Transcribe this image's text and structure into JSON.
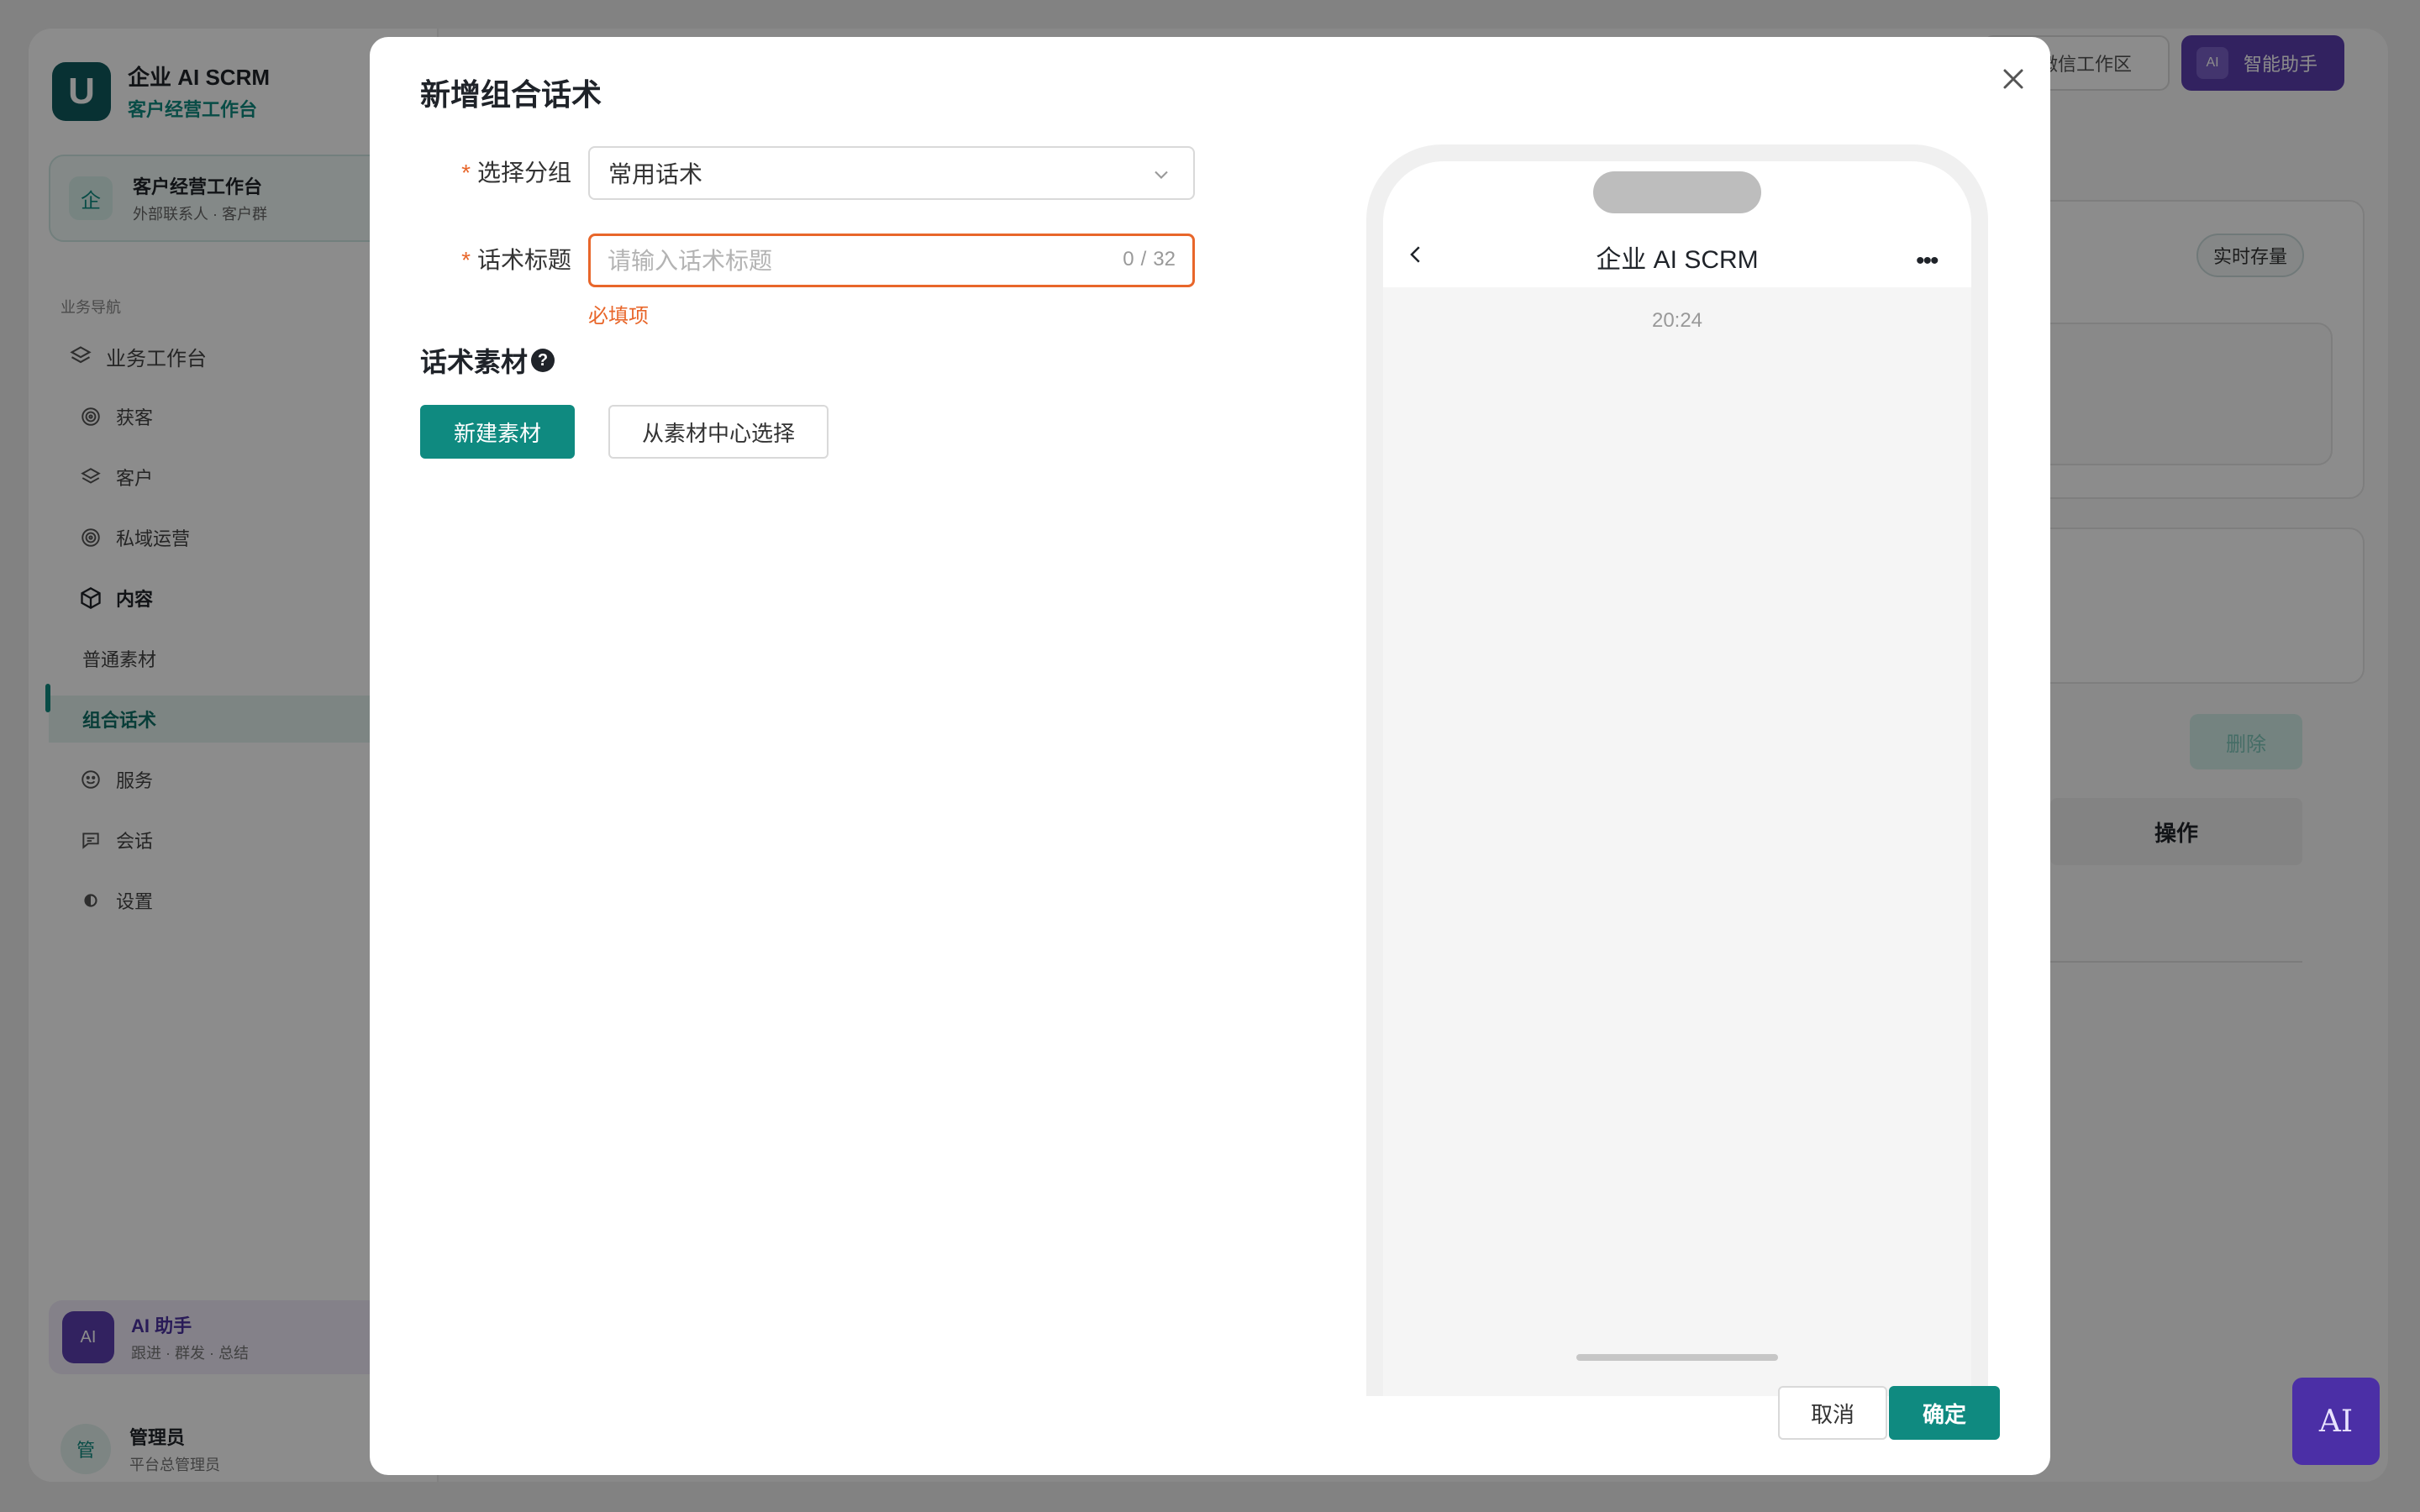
{
  "app": {
    "brand_name": "企业 AI SCRM",
    "brand_sub": "客户经营工作台",
    "workspace": {
      "icon_char": "企",
      "title": "客户经营工作台",
      "sub": "外部联系人 · 客户群"
    },
    "nav_label": "业务导航",
    "nav": [
      {
        "label": "业务工作台",
        "icon": "layers-icon"
      },
      {
        "label": "获客",
        "icon": "target-icon"
      },
      {
        "label": "客户",
        "icon": "layers-icon"
      },
      {
        "label": "私域运营",
        "icon": "target-icon"
      },
      {
        "label": "内容",
        "icon": "cube-icon"
      },
      {
        "label": "普通素材"
      },
      {
        "label": "组合话术"
      },
      {
        "label": "服务",
        "icon": "smile-icon"
      },
      {
        "label": "会话",
        "icon": "chat-icon"
      },
      {
        "label": "设置",
        "icon": "settings-icon"
      }
    ],
    "ai_card": {
      "badge": "AI",
      "title": "AI 助手",
      "sub": "跟进 · 群发 · 总结"
    },
    "user": {
      "avatar": "管",
      "name": "管理员",
      "sub": "平台总管理员"
    },
    "top": {
      "workbench_label": "业微信工作区",
      "ai_badge": "AI",
      "ai_label": "智能助手"
    },
    "realtime_label": "实时存量",
    "delete_label": "删除",
    "table_action_header": "操作",
    "ai_float_label": "AI"
  },
  "modal": {
    "title": "新增组合话术",
    "group_label": "选择分组",
    "group_value": "常用话术",
    "title_label": "话术标题",
    "title_placeholder": "请输入话术标题",
    "title_value": "",
    "count_current": "0",
    "count_max": "32",
    "error_text": "必填项",
    "required_mark": "*",
    "material_label": "话术素材",
    "help_char": "?",
    "new_material_btn": "新建素材",
    "choose_material_btn": "从素材中心选择",
    "preview": {
      "title": "企业 AI SCRM",
      "more": "•••",
      "time": "20:24"
    },
    "cancel_btn": "取消",
    "ok_btn": "确定"
  },
  "colors": {
    "primary": "#0f8a80",
    "error": "#e8662a",
    "ai_purple": "#5b3fb0"
  }
}
